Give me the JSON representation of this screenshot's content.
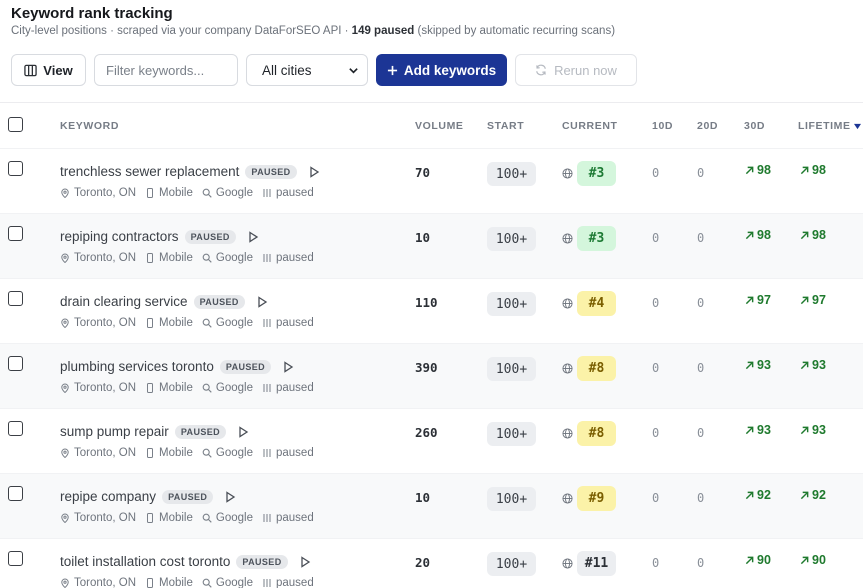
{
  "header": {
    "title": "Keyword rank tracking",
    "subtitle_prefix": "City-level positions · scraped via your company DataForSEO API · ",
    "paused_count": "149 paused",
    "subtitle_suffix": " (skipped by automatic recurring scans)"
  },
  "toolbar": {
    "view_label": "View",
    "filter_placeholder": "Filter keywords...",
    "city_select_value": "All cities",
    "add_label": "Add keywords",
    "rerun_label": "Rerun now"
  },
  "columns": {
    "keyword": "KEYWORD",
    "volume": "VOLUME",
    "start": "START",
    "current": "CURRENT",
    "d10": "10D",
    "d20": "20D",
    "d30": "30D",
    "lifetime": "LIFETIME"
  },
  "colors": {
    "green_bg": "#d4f6dc",
    "green_fg": "#1d7a34",
    "yellow_bg": "#fbf2a8",
    "yellow_fg": "#7a5e00",
    "gray_bg": "#eceef1",
    "gray_fg": "#2c3036",
    "accent": "#1c3595"
  },
  "rows": [
    {
      "keyword": "trenchless sewer replacement",
      "badge": "PAUSED",
      "location": "Toronto, ON",
      "device": "Mobile",
      "engine": "Google",
      "status": "paused",
      "volume": "70",
      "start": "100+",
      "current": "#3",
      "tier": "green",
      "d10": "0",
      "d20": "0",
      "d30": "98",
      "lifetime": "98"
    },
    {
      "keyword": "repiping contractors",
      "badge": "PAUSED",
      "location": "Toronto, ON",
      "device": "Mobile",
      "engine": "Google",
      "status": "paused",
      "volume": "10",
      "start": "100+",
      "current": "#3",
      "tier": "green",
      "d10": "0",
      "d20": "0",
      "d30": "98",
      "lifetime": "98"
    },
    {
      "keyword": "drain clearing service",
      "badge": "PAUSED",
      "location": "Toronto, ON",
      "device": "Mobile",
      "engine": "Google",
      "status": "paused",
      "volume": "110",
      "start": "100+",
      "current": "#4",
      "tier": "yellow",
      "d10": "0",
      "d20": "0",
      "d30": "97",
      "lifetime": "97"
    },
    {
      "keyword": "plumbing services toronto",
      "badge": "PAUSED",
      "location": "Toronto, ON",
      "device": "Mobile",
      "engine": "Google",
      "status": "paused",
      "volume": "390",
      "start": "100+",
      "current": "#8",
      "tier": "yellow",
      "d10": "0",
      "d20": "0",
      "d30": "93",
      "lifetime": "93"
    },
    {
      "keyword": "sump pump repair",
      "badge": "PAUSED",
      "location": "Toronto, ON",
      "device": "Mobile",
      "engine": "Google",
      "status": "paused",
      "volume": "260",
      "start": "100+",
      "current": "#8",
      "tier": "yellow",
      "d10": "0",
      "d20": "0",
      "d30": "93",
      "lifetime": "93"
    },
    {
      "keyword": "repipe company",
      "badge": "PAUSED",
      "location": "Toronto, ON",
      "device": "Mobile",
      "engine": "Google",
      "status": "paused",
      "volume": "10",
      "start": "100+",
      "current": "#9",
      "tier": "yellow",
      "d10": "0",
      "d20": "0",
      "d30": "92",
      "lifetime": "92"
    },
    {
      "keyword": "toilet installation cost toronto",
      "badge": "PAUSED",
      "location": "Toronto, ON",
      "device": "Mobile",
      "engine": "Google",
      "status": "paused",
      "volume": "20",
      "start": "100+",
      "current": "#11",
      "tier": "gray",
      "d10": "0",
      "d20": "0",
      "d30": "90",
      "lifetime": "90"
    }
  ]
}
